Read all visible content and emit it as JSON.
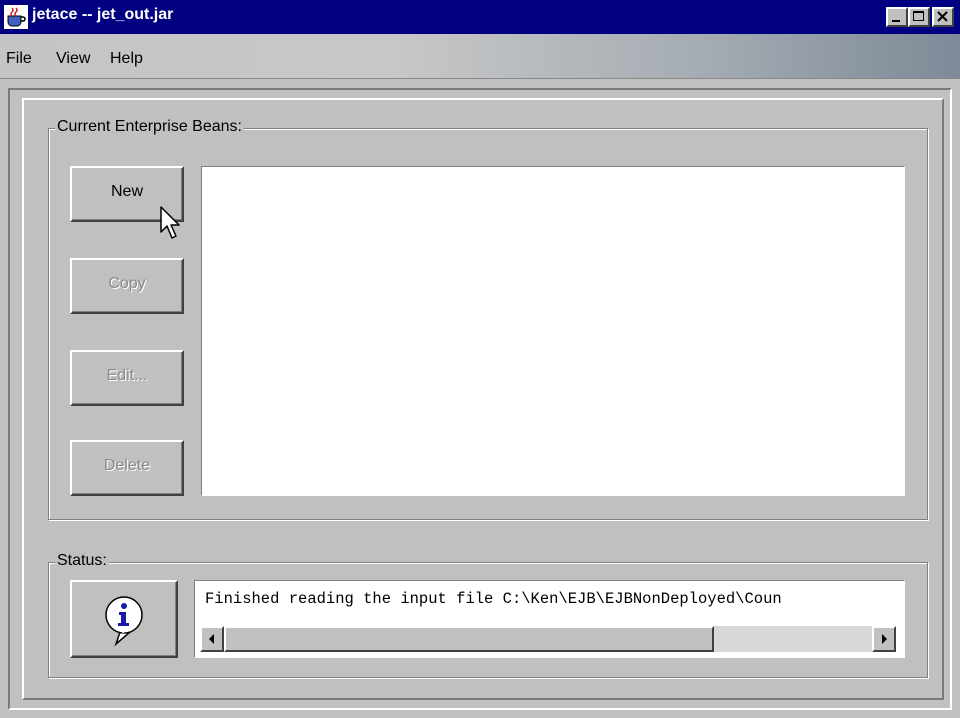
{
  "window": {
    "title": "jetace -- jet_out.jar",
    "app_icon": "java-coffee-icon",
    "controls": [
      "minimize-icon",
      "maximize-icon",
      "close-icon"
    ]
  },
  "menu": {
    "items": [
      "File",
      "View",
      "Help"
    ]
  },
  "beans_group": {
    "label": "Current Enterprise Beans:",
    "buttons": {
      "new": "New",
      "copy": "Copy",
      "edit": "Edit...",
      "delete": "Delete"
    }
  },
  "status_group": {
    "label": "Status:",
    "icon": "info-icon",
    "message": "Finished reading the input file C:\\Ken\\EJB\\EJBNonDeployed\\Coun"
  },
  "colors": {
    "titlebar": "#000080",
    "window": "#c0c0c0",
    "disabled_text": "#8a8a8a",
    "info_blue": "#1a1aa6"
  }
}
